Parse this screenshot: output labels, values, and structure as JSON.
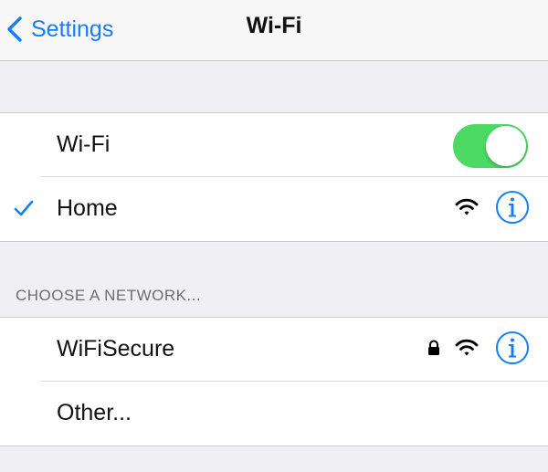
{
  "navbar": {
    "back_label": "Settings",
    "title": "Wi-Fi"
  },
  "wifi_toggle": {
    "label": "Wi-Fi",
    "on": true,
    "on_color": "#4cd964"
  },
  "connected_network": {
    "name": "Home",
    "icons": [
      "checkmark-icon",
      "wifi-signal-icon",
      "info-icon"
    ]
  },
  "networks_section": {
    "header": "CHOOSE A NETWORK...",
    "items": [
      {
        "name": "WiFiSecure",
        "secured": true,
        "icons": [
          "lock-icon",
          "wifi-signal-icon",
          "info-icon"
        ]
      },
      {
        "name": "Other..."
      }
    ]
  },
  "colors": {
    "accent": "#147efb",
    "background": "#efeff4",
    "separator": "#c8c7cc"
  }
}
